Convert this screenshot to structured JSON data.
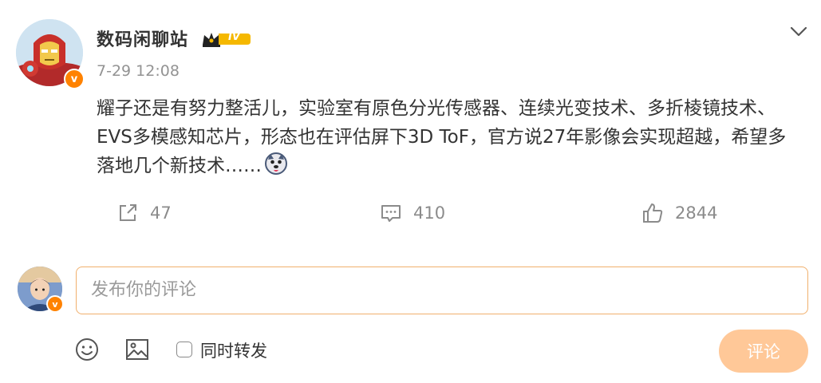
{
  "post": {
    "author": "数码闲聊站",
    "level_badge": "IV",
    "verified_badge": "v",
    "timestamp": "7-29 12:08",
    "text": "耀子还是有努力整活儿，实验室有原色分光传感器、连续光变技术、多折棱镜技术、EVS多模感知芯片，形态也在评估屏下3D ToF，官方说27年影像会实现超越，希望多落地几个新技术……",
    "emoji": "doge-emoji"
  },
  "actions": {
    "repost_count": "47",
    "comment_count": "410",
    "like_count": "2844"
  },
  "comment": {
    "placeholder": "发布你的评论",
    "value": "",
    "also_repost_label": "同时转发",
    "also_repost_checked": false,
    "submit_label": "评论",
    "commenter_verified_badge": "v"
  },
  "colors": {
    "accent": "#ff8200",
    "input_border": "#f1b06d",
    "submit_bg": "#ffc898",
    "muted_text": "#939393",
    "level_badge": "#f5b800"
  },
  "icons": [
    "chevron-down-icon",
    "repost-icon",
    "comment-icon",
    "like-icon",
    "emoji-icon",
    "image-icon"
  ]
}
